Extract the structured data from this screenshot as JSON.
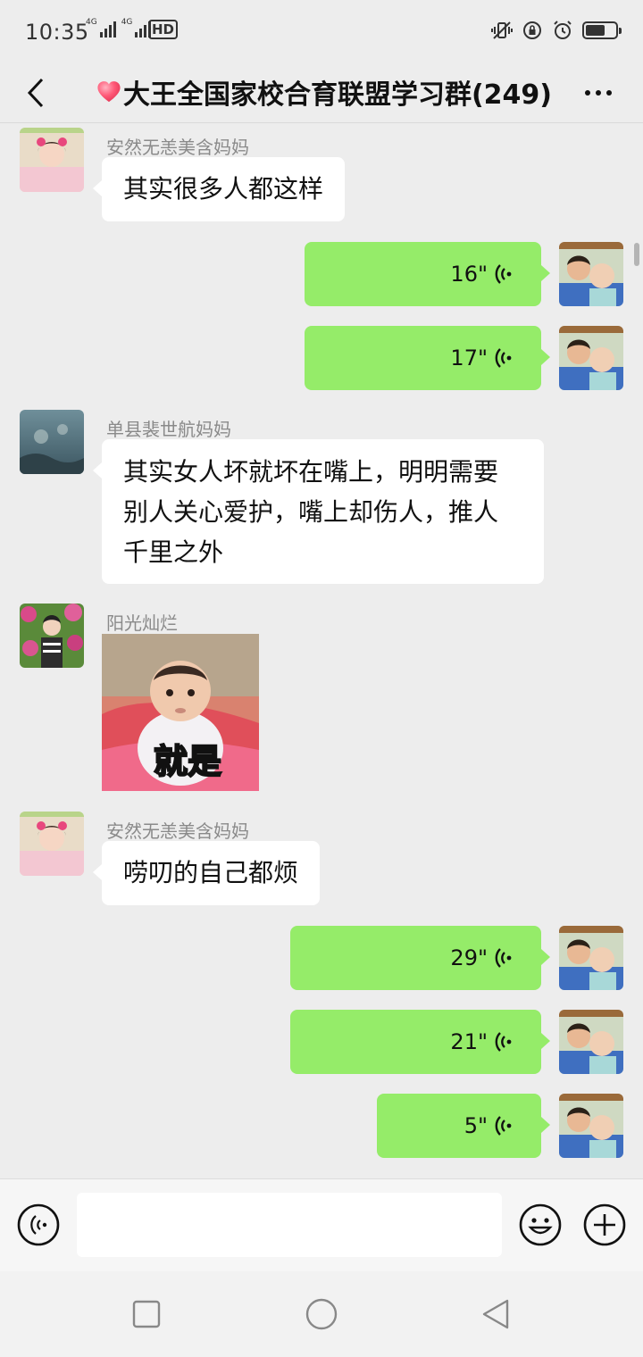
{
  "status_bar": {
    "time": "10:35",
    "network_1": "4G",
    "network_2": "4G",
    "hd": "HD",
    "battery_level": 0.65
  },
  "nav": {
    "title": "大王全国家校合育联盟学习群(249)",
    "back_icon": "chevron-left-icon",
    "more_icon": "more-dots-icon",
    "heart_color": "#ff4f6d"
  },
  "messages": [
    {
      "side": "left",
      "sender": "安然无恙美含妈妈",
      "text": "其实很多人都这样"
    },
    {
      "side": "right",
      "type": "voice",
      "duration": "16\""
    },
    {
      "side": "right",
      "type": "voice",
      "duration": "17\""
    },
    {
      "side": "left",
      "sender": "单县裴世航妈妈",
      "lines": [
        "其实女人坏就坏在嘴上，明明需要",
        "别人关心爱护，嘴上却伤人，推人",
        "千里之外"
      ]
    },
    {
      "side": "left",
      "sender": "阳光灿烂",
      "type": "sticker",
      "sticker_text": "就是"
    },
    {
      "side": "left",
      "sender": "安然无恙美含妈妈",
      "text": "唠叨的自己都烦"
    },
    {
      "side": "right",
      "type": "voice",
      "duration": "29\""
    },
    {
      "side": "right",
      "type": "voice",
      "duration": "21\""
    },
    {
      "side": "right",
      "type": "voice",
      "duration": "5\""
    }
  ],
  "input_bar": {
    "placeholder": "",
    "voice_icon": "voice-mode-icon",
    "emoji_icon": "emoji-icon",
    "plus_icon": "plus-icon"
  },
  "colors": {
    "background": "#ededed",
    "own_bubble": "#95ec69",
    "other_bubble": "#ffffff"
  }
}
